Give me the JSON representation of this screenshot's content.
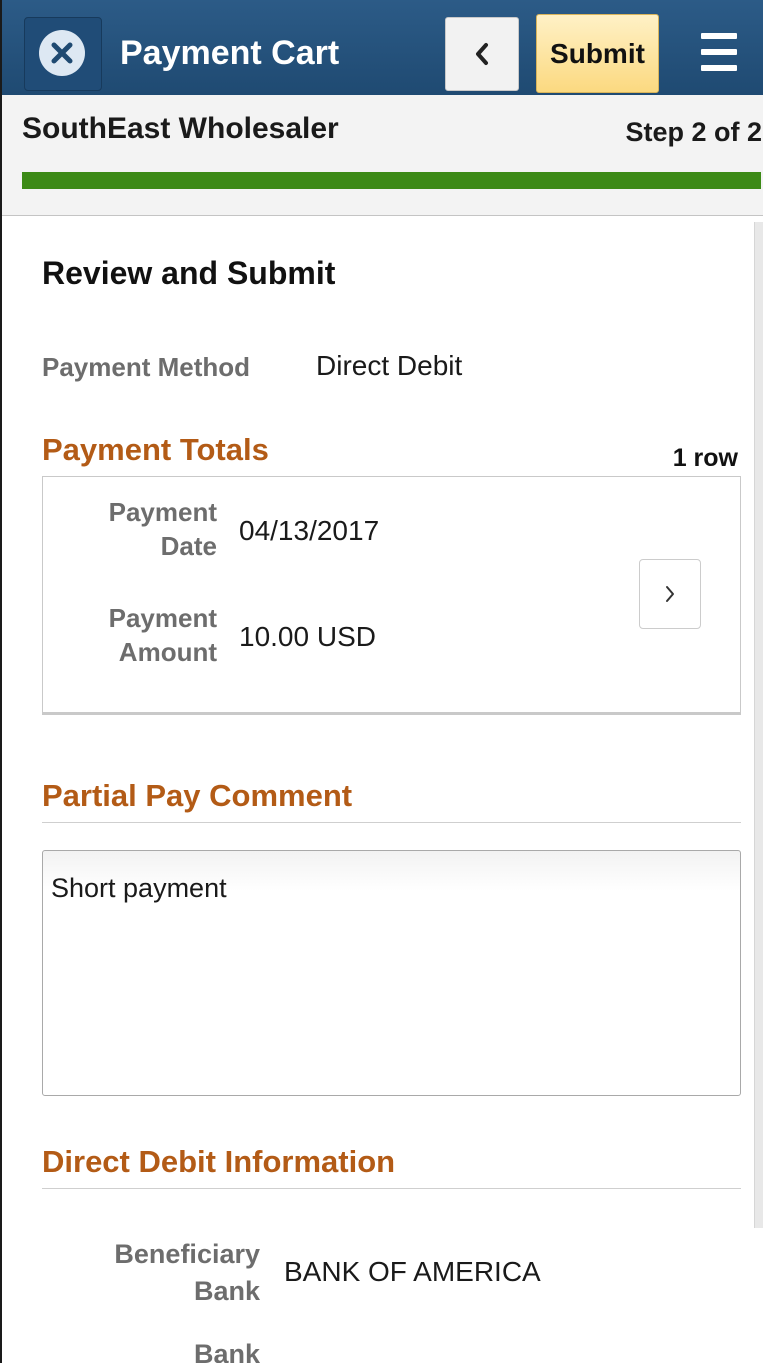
{
  "header": {
    "title": "Payment Cart",
    "submit_label": "Submit"
  },
  "subheader": {
    "company": "SouthEast Wholesaler",
    "step": "Step 2 of 2",
    "progress_fraction": 1.0,
    "progress_color": "#3c8a16"
  },
  "review": {
    "title": "Review and Submit",
    "payment_method_label": "Payment Method",
    "payment_method_value": "Direct Debit"
  },
  "payment_totals": {
    "title": "Payment Totals",
    "row_count": "1 row",
    "rows": [
      {
        "date_label_1": "Payment",
        "date_label_2": "Date",
        "date_value": "04/13/2017",
        "amount_label_1": "Payment",
        "amount_label_2": "Amount",
        "amount_value": "10.00 USD"
      }
    ]
  },
  "partial_pay": {
    "title": "Partial Pay Comment",
    "comment": "Short payment"
  },
  "direct_debit": {
    "title": "Direct Debit Information",
    "bank_label_1": "Beneficiary",
    "bank_label_2": "Bank",
    "bank_value": "BANK OF AMERICA",
    "next_label_partial": "Bank"
  },
  "colors": {
    "header_bg": "#1f4a72",
    "submit_bg": "#fbd980",
    "group_title": "#b35b16"
  },
  "icons": {
    "close": "close-icon",
    "back": "chevron-left-icon",
    "menu": "hamburger-menu-icon",
    "row_detail": "chevron-right-icon"
  }
}
